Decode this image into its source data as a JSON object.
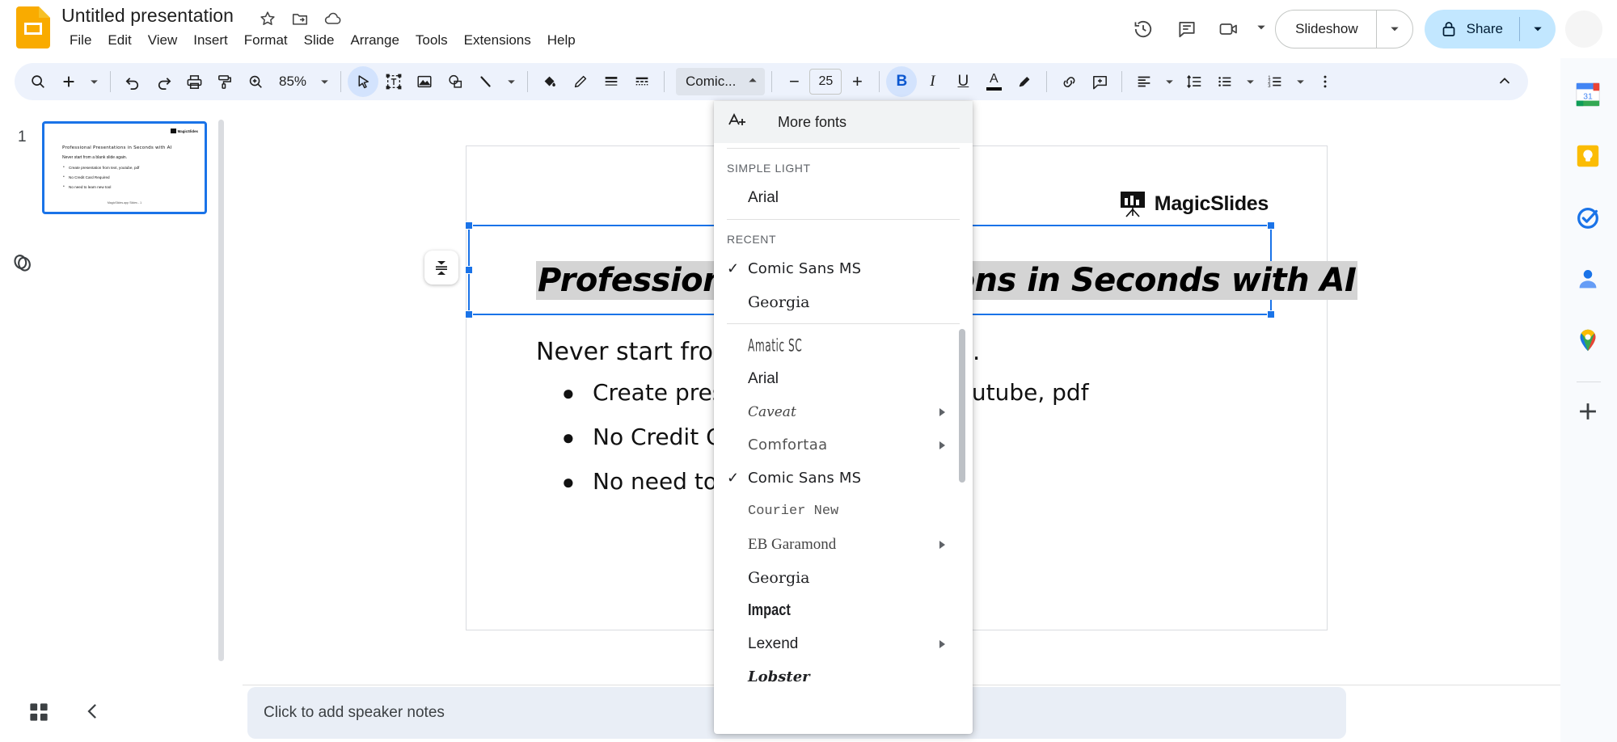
{
  "app": {
    "title": "Untitled presentation",
    "logo_icon": "google-slides-logo",
    "title_icons": [
      "star-icon",
      "move-to-folder-icon",
      "cloud-saved-icon"
    ]
  },
  "menubar": {
    "items": [
      {
        "label": "File"
      },
      {
        "label": "Edit"
      },
      {
        "label": "View"
      },
      {
        "label": "Insert"
      },
      {
        "label": "Format"
      },
      {
        "label": "Slide"
      },
      {
        "label": "Arrange"
      },
      {
        "label": "Tools"
      },
      {
        "label": "Extensions"
      },
      {
        "label": "Help"
      }
    ]
  },
  "header_right": {
    "history_icon": "version-history-icon",
    "comment_icon": "comment-icon",
    "meet_icon": "google-meet-icon",
    "slideshow_label": "Slideshow",
    "share_label": "Share",
    "share_lock_icon": "lock-icon"
  },
  "toolbar": {
    "search_icon": "search-icon",
    "new_slide_icon": "plus-icon",
    "undo_icon": "undo-icon",
    "redo_icon": "redo-icon",
    "print_icon": "print-icon",
    "paint_format_icon": "paint-format-icon",
    "zoom_icon": "zoom-icon",
    "zoom_value": "85%",
    "select_icon": "cursor-select-icon",
    "textbox_icon": "text-box-icon",
    "image_icon": "insert-image-icon",
    "shape_icon": "shape-icon",
    "line_icon": "line-icon",
    "fill_color_icon": "fill-color-icon",
    "border_color_icon": "border-color-icon",
    "border_weight_icon": "border-weight-icon",
    "border_dash_icon": "border-dash-icon",
    "font_name": "Comic...",
    "font_size": "25",
    "decrease_font_label": "−",
    "increase_font_label": "+",
    "bold_label": "B",
    "italic_label": "I",
    "underline_label": "U",
    "text_color_label": "A",
    "highlight_icon": "highlight-icon",
    "link_icon": "link-icon",
    "comment_add_icon": "add-comment-icon",
    "align_icon": "align-left-icon",
    "line_spacing_icon": "line-spacing-icon",
    "bulleted_list_icon": "bulleted-list-icon",
    "numbered_list_icon": "numbered-list-icon",
    "more_icon": "more-vertical-icon",
    "collapse_icon": "chevron-up-icon"
  },
  "font_menu": {
    "more_fonts_label": "More fonts",
    "more_fonts_icon": "add-font-icon",
    "sections": [
      {
        "label": "SIMPLE LIGHT",
        "items": [
          {
            "name": "Arial",
            "checked": false,
            "submenu": false,
            "style": "f-arial"
          }
        ]
      },
      {
        "label": "RECENT",
        "items": [
          {
            "name": "Comic Sans MS",
            "checked": true,
            "submenu": false,
            "style": "f-comic"
          },
          {
            "name": "Georgia",
            "checked": false,
            "submenu": false,
            "style": "f-georgia"
          }
        ]
      },
      {
        "label": "",
        "items": [
          {
            "name": "Amatic SC",
            "checked": false,
            "submenu": false,
            "style": "f-amatic"
          },
          {
            "name": "Arial",
            "checked": false,
            "submenu": false,
            "style": "f-arial"
          },
          {
            "name": "Caveat",
            "checked": false,
            "submenu": true,
            "style": "f-caveat"
          },
          {
            "name": "Comfortaa",
            "checked": false,
            "submenu": true,
            "style": "f-comfort"
          },
          {
            "name": "Comic Sans MS",
            "checked": true,
            "submenu": false,
            "style": "f-comic"
          },
          {
            "name": "Courier New",
            "checked": false,
            "submenu": false,
            "style": "f-courier"
          },
          {
            "name": "EB Garamond",
            "checked": false,
            "submenu": true,
            "style": "f-garamond"
          },
          {
            "name": "Georgia",
            "checked": false,
            "submenu": false,
            "style": "f-georgia"
          },
          {
            "name": "Impact",
            "checked": false,
            "submenu": false,
            "style": "f-impact"
          },
          {
            "name": "Lexend",
            "checked": false,
            "submenu": true,
            "style": "f-lexend"
          },
          {
            "name": "Lobster",
            "checked": false,
            "submenu": false,
            "style": "f-lobster"
          }
        ]
      }
    ],
    "check_glyph": "✓"
  },
  "filmstrip": {
    "slide_number": "1",
    "layers_icon": "layers-icon"
  },
  "slide": {
    "brand_name": "MagicSlides",
    "brand_icon": "magicslides-easel-icon",
    "title": "Professional Presentations in Seconds with AI",
    "title_visible_left": "Professional",
    "title_visible_right": "Seconds with AI",
    "subtitle": "Never start from a blank slide again.",
    "bullets": [
      {
        "text": "Create presentation from text, youtube, pdf",
        "visible_left": "Create pres",
        "visible_right": "e, pdf"
      },
      {
        "text": "No Credit Card Required",
        "visible_left": "No Credit Ca"
      },
      {
        "text": "No need to learn new tool",
        "visible_left": "No need to ",
        "red_part": "l"
      }
    ],
    "footer": "MagicSlides.app Slides - 1",
    "valign_icon": "vertical-align-icon"
  },
  "right_sidebar": {
    "items": [
      {
        "icon": "google-calendar-icon",
        "label": "Calendar"
      },
      {
        "icon": "google-keep-icon",
        "label": "Keep"
      },
      {
        "icon": "google-tasks-icon",
        "label": "Tasks"
      },
      {
        "icon": "google-contacts-icon",
        "label": "Contacts"
      },
      {
        "icon": "google-maps-icon",
        "label": "Maps"
      },
      {
        "icon": "add-ons-plus-icon",
        "label": "Get add-ons"
      }
    ]
  },
  "bottom": {
    "grid_view_icon": "grid-view-icon",
    "collapse_notes_icon": "chevron-left-icon",
    "speaker_notes_placeholder": "Click to add speaker notes"
  },
  "colors": {
    "accent_blue": "#1a73e8",
    "toolbar_bg": "#edf2fc",
    "share_bg": "#c2e7ff",
    "slides_yellow": "#f9ab00",
    "selection_gray": "#d4d4d4",
    "red_text": "#c62828"
  }
}
